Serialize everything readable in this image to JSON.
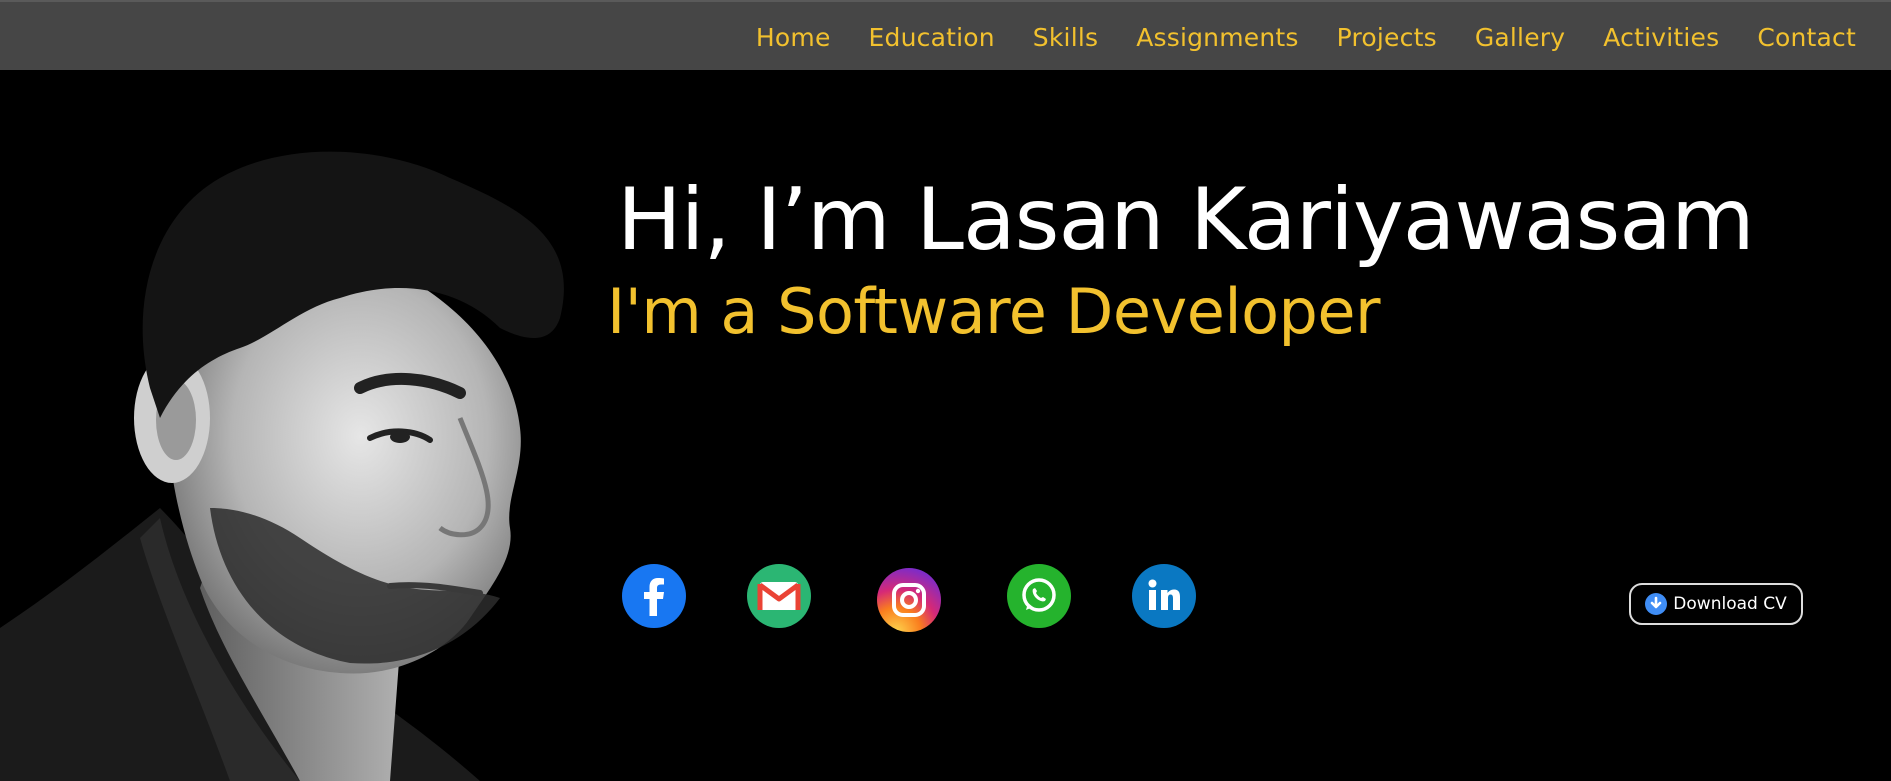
{
  "nav": {
    "items": [
      "Home",
      "Education",
      "Skills",
      "Assignments",
      "Projects",
      "Gallery",
      "Activities",
      "Contact"
    ],
    "color": "#f2c12e",
    "background": "#464646"
  },
  "hero": {
    "headline": "Hi, I’m Lasan Kariyawasam",
    "subline": "I'm a Software Developer",
    "portrait_icon": "person-portrait",
    "social": [
      {
        "icon": "facebook-icon",
        "color": "#1877f2"
      },
      {
        "icon": "gmail-icon",
        "color": "#2bb673"
      },
      {
        "icon": "instagram-icon",
        "color": "#e1306c"
      },
      {
        "icon": "whatsapp-icon",
        "color": "#25b32d"
      },
      {
        "icon": "linkedin-icon",
        "color": "#0a78c2"
      }
    ],
    "download_label": "Download CV",
    "download_icon": "download-icon"
  }
}
